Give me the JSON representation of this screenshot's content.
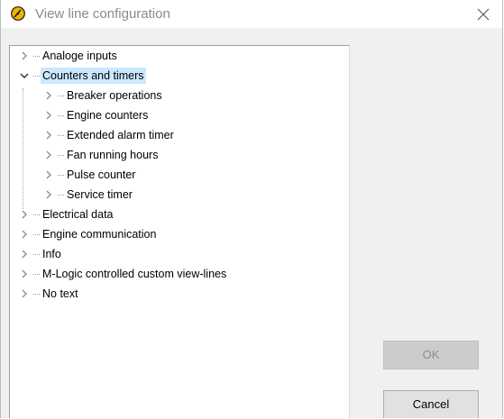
{
  "window": {
    "title": "View line configuration"
  },
  "tree": {
    "items": [
      {
        "label": "Analoge inputs",
        "expanded": false,
        "level": 0
      },
      {
        "label": "Counters and timers",
        "expanded": true,
        "level": 0,
        "selected": true,
        "children": [
          {
            "label": "Breaker operations"
          },
          {
            "label": "Engine counters"
          },
          {
            "label": "Extended alarm timer"
          },
          {
            "label": "Fan running hours"
          },
          {
            "label": "Pulse counter"
          },
          {
            "label": "Service timer"
          }
        ]
      },
      {
        "label": "Electrical data",
        "expanded": false,
        "level": 0
      },
      {
        "label": "Engine communication",
        "expanded": false,
        "level": 0
      },
      {
        "label": "Info",
        "expanded": false,
        "level": 0
      },
      {
        "label": "M-Logic controlled custom view-lines",
        "expanded": false,
        "level": 0
      },
      {
        "label": "No text",
        "expanded": false,
        "level": 0
      }
    ]
  },
  "buttons": {
    "ok_label": "OK",
    "ok_enabled": false,
    "cancel_label": "Cancel"
  },
  "icons": {
    "app": "gauge-icon",
    "close": "close-icon",
    "collapsed": "chevron-right-icon",
    "expanded": "chevron-down-icon"
  },
  "colors": {
    "selection": "#cce8ff",
    "icon_yellow": "#f2b400"
  }
}
